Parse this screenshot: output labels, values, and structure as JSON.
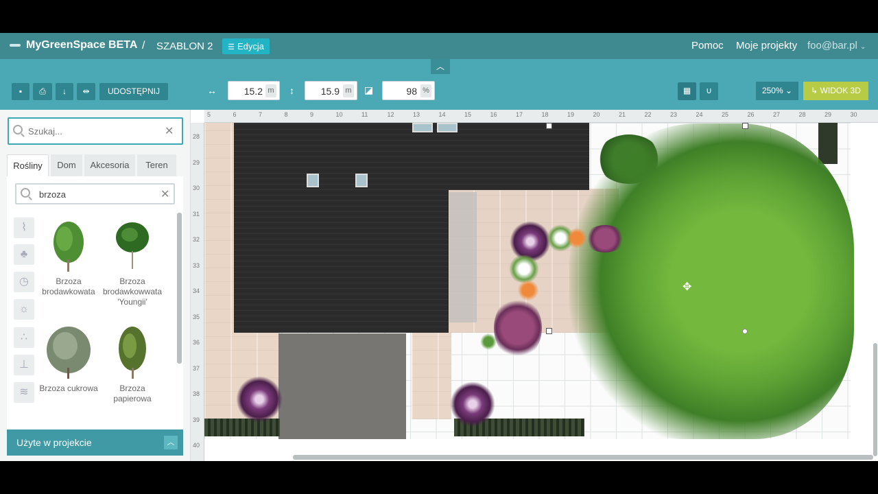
{
  "header": {
    "brand": "MyGreenSpace BETA",
    "separator": "/",
    "project": "SZABLON 2",
    "edit_label": "Edycja",
    "help": "Pomoc",
    "my_projects": "Moje projekty",
    "user": "foo@bar.pl"
  },
  "toolbar": {
    "share_label": "UDOSTĘPNIJ",
    "width_value": "15.2",
    "width_unit": "m",
    "height_value": "15.9",
    "height_unit": "m",
    "opacity_value": "98",
    "opacity_unit": "%",
    "zoom_label": "250%",
    "view3d_label": "WIDOK 3D"
  },
  "sidebar": {
    "search_placeholder": "Szukaj...",
    "tabs": [
      "Rośliny",
      "Dom",
      "Akcesoria",
      "Teren"
    ],
    "filter_value": "brzoza",
    "plants": [
      {
        "name": "Brzoza brodawkowata"
      },
      {
        "name": "Brzoza brodawkowwata 'Youngii'"
      },
      {
        "name": "Brzoza cukrowa"
      },
      {
        "name": "Brzoza papierowa"
      }
    ],
    "used_in_project": "Użyte w projekcie"
  },
  "ruler": {
    "top": [
      "5",
      "6",
      "7",
      "8",
      "9",
      "10",
      "11",
      "12",
      "13",
      "14",
      "15",
      "16",
      "17",
      "18",
      "19",
      "20",
      "21",
      "22",
      "23",
      "24",
      "25",
      "26",
      "27",
      "28",
      "29",
      "30"
    ],
    "left": [
      "28",
      "29",
      "30",
      "31",
      "32",
      "33",
      "34",
      "35",
      "36",
      "37",
      "38",
      "39",
      "40"
    ]
  },
  "colors": {
    "header": "#3f8a90",
    "toolbar": "#4aa9b4",
    "accent": "#22b4c4",
    "view3d": "#b7cc44"
  }
}
